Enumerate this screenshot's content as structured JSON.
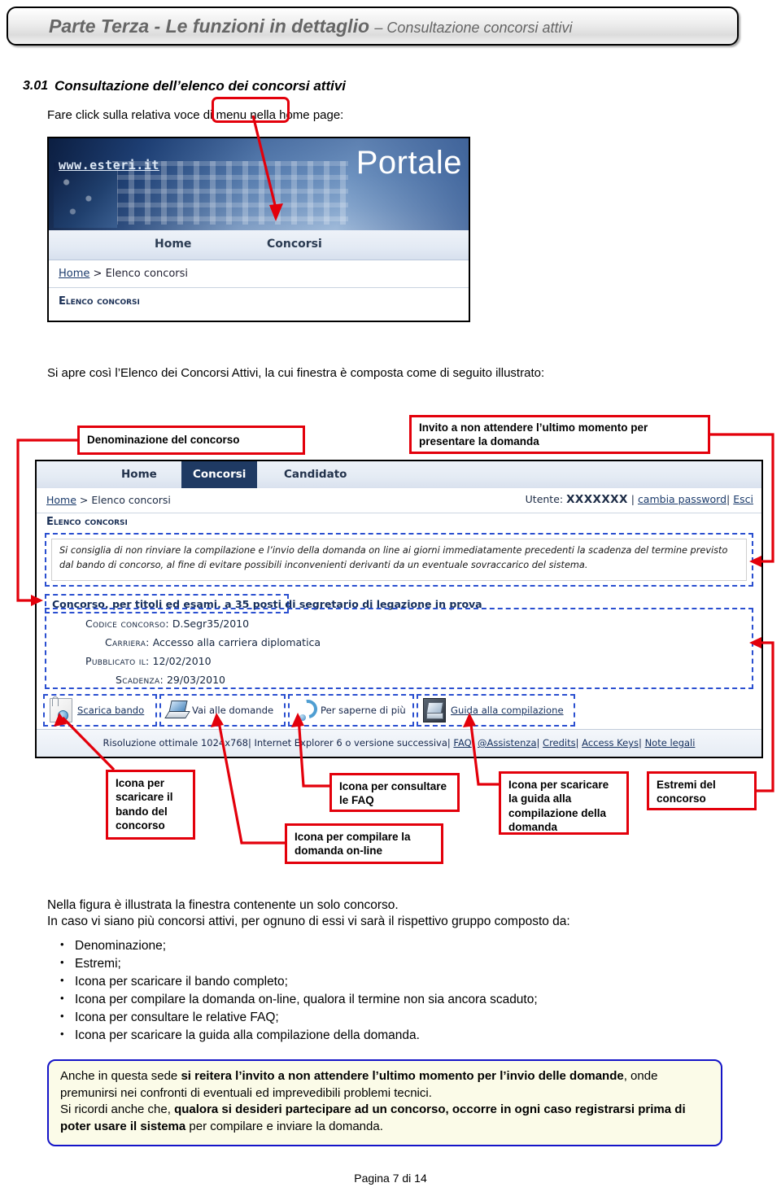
{
  "banner": {
    "part": "Parte Terza - Le funzioni in dettaglio ",
    "subject": "– Consultazione concorsi attivi"
  },
  "section": {
    "number": "3.01",
    "title": "Consultazione dell’elenco dei concorsi attivi",
    "intro1": "Fare click sulla relativa voce di menu nella home page:",
    "intro2": "Si apre così l’Elenco dei Concorsi Attivi, la cui finestra è composta come di seguito illustrato:"
  },
  "figure1": {
    "site_url": "www.esteri.it",
    "hero_title": "Portale",
    "menu": [
      "Home",
      "Concorsi"
    ],
    "breadcrumb_home": "Home",
    "breadcrumb_sep": " > ",
    "breadcrumb_current": "Elenco concorsi",
    "page_heading": "Elenco concorsi"
  },
  "figure2": {
    "tabs": [
      "Home",
      "Concorsi",
      "Candidato"
    ],
    "breadcrumb_home": "Home",
    "breadcrumb_sep": " > ",
    "breadcrumb_current": "Elenco concorsi",
    "user_label": "Utente:",
    "user_name": "XXXXXXX",
    "user_sep1": " | ",
    "change_password": "cambia password",
    "user_sep2": "| ",
    "logout": "Esci",
    "page_heading": "Elenco concorsi",
    "notice": "Si consiglia di non rinviare la compilazione e l’invio della domanda on line ai giorni immediatamente precedenti la scadenza del termine previsto dal bando di concorso, al fine di evitare possibili inconvenienti derivanti da un eventuale sovraccarico del sistema.",
    "concorso_title": "Concorso, per titoli ed esami, a 35 posti di segretario di legazione in prova",
    "details": [
      {
        "label": "Codice concorso:",
        "value": "D.Segr35/2010"
      },
      {
        "label": "Carriera:",
        "value": "Accesso alla carriera diplomatica"
      },
      {
        "label": "Pubblicato il:",
        "value": "12/02/2010"
      },
      {
        "label": "Scadenza:",
        "value": "29/03/2010"
      }
    ],
    "icons": [
      {
        "icon": "document-download-icon",
        "label": "Scarica bando",
        "link": true
      },
      {
        "icon": "laptop-icon",
        "label": "Vai alle domande",
        "link": false
      },
      {
        "icon": "question-mark-icon",
        "label": "Per saperne di più",
        "link": false
      },
      {
        "icon": "guide-book-icon",
        "label": "Guida alla compilazione",
        "link": true
      }
    ],
    "footer": {
      "resolution": "Risoluzione ottimale 1024x768| Internet Explorer 6 o versione successiva| ",
      "links": [
        "FAQ",
        "@Assistenza",
        "Credits",
        "Access Keys",
        "Note legali"
      ]
    }
  },
  "callouts": {
    "denominazione": "Denominazione del concorso",
    "invito": "Invito a non attendere l’ultimo momento per presentare la domanda",
    "bando": "Icona per scaricare il bando del concorso",
    "faq": "Icona per consultare le FAQ",
    "compilare": "Icona per compilare la domanda on-line",
    "guida": "Icona per scaricare la guida alla compilazione della domanda",
    "estremi": "Estremi del concorso"
  },
  "body": {
    "para_line1": "Nella figura è illustrata la finestra contenente un solo concorso.",
    "para_line2": "In caso vi siano più concorsi attivi, per ognuno di essi vi sarà il rispettivo gruppo composto da:",
    "bullets": [
      "Denominazione;",
      "Estremi;",
      "Icona per scaricare il bando completo;",
      "Icona per compilare la domanda on-line, qualora il termine non sia ancora scaduto;",
      "Icona per consultare le relative FAQ;",
      "Icona per scaricare la guida alla compilazione della domanda."
    ]
  },
  "note": {
    "l1_a": "Anche in questa sede ",
    "l1_b": "si reitera l’invito a non attendere l’ultimo momento per l’invio delle domande",
    "l1_c": ", onde premunirsi nei confronti di eventuali ed imprevedibili problemi tecnici.",
    "l2_a": "Si ricordi anche che, ",
    "l2_b": "qualora si desideri partecipare ad un concorso, occorre in ogni caso registrarsi prima di poter usare il sistema",
    "l2_c": " per compilare e inviare la domanda."
  },
  "footer": {
    "page_label": "Pagina  7 di 14"
  },
  "colors": {
    "annotation_red": "#e3000b",
    "dashed_blue": "#2a4fd0",
    "note_border": "#1414c8",
    "note_bg": "#fbfbe8",
    "tab_active": "#1f3a63"
  }
}
